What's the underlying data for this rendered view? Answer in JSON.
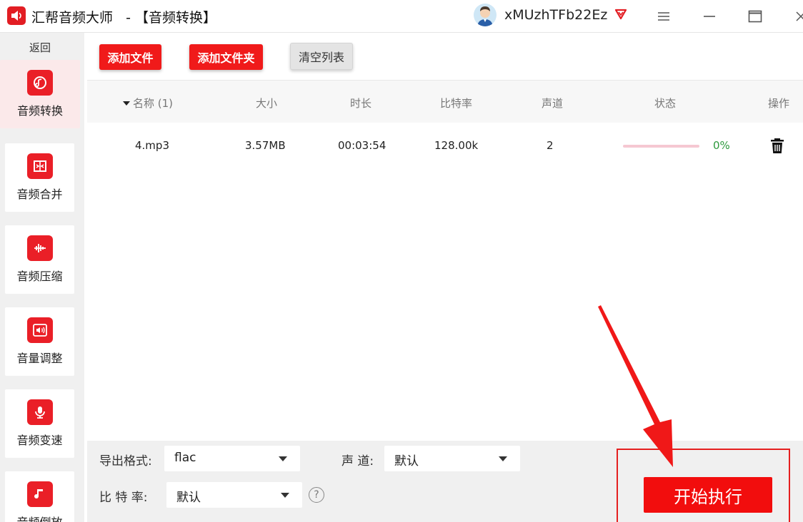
{
  "window": {
    "title": "汇帮音频大师   - 【音频转换】",
    "user_name": "xMUzhTFb22Ez"
  },
  "sidebar": {
    "back_label": "返回",
    "items": [
      {
        "label": "音频转换",
        "icon": "audio-convert-icon",
        "active": true
      },
      {
        "label": "音频合并",
        "icon": "audio-merge-icon",
        "active": false
      },
      {
        "label": "音频压缩",
        "icon": "audio-compress-icon",
        "active": false
      },
      {
        "label": "音量调整",
        "icon": "volume-adjust-icon",
        "active": false
      },
      {
        "label": "音频变速",
        "icon": "audio-speed-icon",
        "active": false
      },
      {
        "label": "音频倒放",
        "icon": "audio-reverse-icon",
        "active": false
      }
    ]
  },
  "toolbar": {
    "add_file": "添加文件",
    "add_folder": "添加文件夹",
    "clear_list": "清空列表"
  },
  "table": {
    "columns": {
      "name": "名称 (1)",
      "size": "大小",
      "duration": "时长",
      "bitrate": "比特率",
      "channels": "声道",
      "status": "状态",
      "action": "操作"
    },
    "rows": [
      {
        "name": "4.mp3",
        "size": "3.57MB",
        "duration": "00:03:54",
        "bitrate": "128.00k",
        "channels": "2",
        "progress": 0,
        "percent": "0%"
      }
    ]
  },
  "settings": {
    "format_label": "导出格式:",
    "format_value": "flac",
    "channel_label": "声 道:",
    "channel_value": "默认",
    "bitrate_label": "比 特 率:",
    "bitrate_value": "默认",
    "help_glyph": "?",
    "start_button": "开始执行"
  },
  "colors": {
    "brand_red": "#e21d23",
    "active_bg": "#fbe9ea",
    "progress_green": "#2e9a3e"
  }
}
